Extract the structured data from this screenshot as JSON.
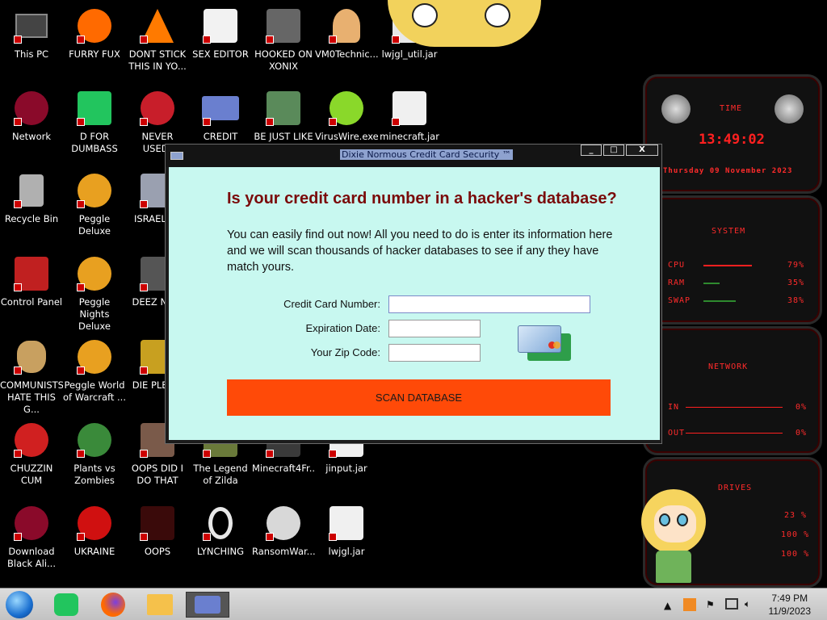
{
  "desktop": {
    "icons": [
      {
        "label": "This PC"
      },
      {
        "label": "FURRY FUX"
      },
      {
        "label": "DONT STICK THIS IN YO..."
      },
      {
        "label": "SEX EDITOR"
      },
      {
        "label": "HOOKED ON XONIX"
      },
      {
        "label": "VM0Technic..."
      },
      {
        "label": "lwjgl_util.jar"
      },
      {
        "label": "Network"
      },
      {
        "label": "D FOR DUMBASS"
      },
      {
        "label": "NEVER USED!"
      },
      {
        "label": "CREDIT CARD CHECKER"
      },
      {
        "label": "BE JUST LIKE THE DUDE!"
      },
      {
        "label": "VirusWire.exe"
      },
      {
        "label": "minecraft.jar"
      },
      {
        "label": "Recycle Bin"
      },
      {
        "label": "Peggle Deluxe"
      },
      {
        "label": "ISRAELS..."
      },
      {
        "label": "Control Panel"
      },
      {
        "label": "Peggle Nights Deluxe"
      },
      {
        "label": "DEEZ NU..."
      },
      {
        "label": "COMMUNISTS HATE THIS G..."
      },
      {
        "label": "Peggle World of Warcraft ..."
      },
      {
        "label": "DIE PLEA..."
      },
      {
        "label": "CHUZZIN CUM"
      },
      {
        "label": "Plants vs Zombies"
      },
      {
        "label": "OOPS DID I DO THAT"
      },
      {
        "label": "The Legend of Zilda"
      },
      {
        "label": "Minecraft4Fr..."
      },
      {
        "label": "jinput.jar"
      },
      {
        "label": "Download Black Ali..."
      },
      {
        "label": "UKRAINE"
      },
      {
        "label": "OOPS"
      },
      {
        "label": "LYNCHING"
      },
      {
        "label": "RansomWar..."
      },
      {
        "label": "lwjgl.jar"
      }
    ]
  },
  "gadget": {
    "time_title": "TIME",
    "time_value": "13:49:02",
    "date_value": "Thursday 09 November 2023",
    "system_title": "SYSTEM",
    "cpu_label": "CPU",
    "cpu_value": "79%",
    "ram_label": "RAM",
    "ram_value": "35%",
    "swap_label": "SWAP",
    "swap_value": "38%",
    "network_title": "NETWORK",
    "in_label": "IN",
    "in_value": "0%",
    "out_label": "OUT",
    "out_value": "0%",
    "drives_title": "DRIVES",
    "drive1_value": "23 %",
    "drive2_value": "100 %",
    "drive3_value": "100 %"
  },
  "window": {
    "title": "Dixie Normous Credit Card Security ™",
    "heading": "Is your credit card number in a hacker's database?",
    "description": "You can easily find out now! All you need to do is enter its information here and we will scan thousands of hacker databases to see if any they have match yours.",
    "fields": {
      "card_label": "Credit Card Number:",
      "card_value": "",
      "exp_label": "Expiration Date:",
      "exp_value": "",
      "zip_label": "Your Zip Code:",
      "zip_value": ""
    },
    "scan_button": "SCAN DATABASE",
    "min_glyph": "_",
    "max_glyph": "□",
    "close_glyph": "X"
  },
  "taskbar": {
    "time": "7:49 PM",
    "date": "11/9/2023"
  },
  "colors": {
    "window_bg": "#c8f8f0",
    "heading": "#7a0a0a",
    "scan_button": "#ff4a08",
    "gadget_red": "#ff2020"
  }
}
